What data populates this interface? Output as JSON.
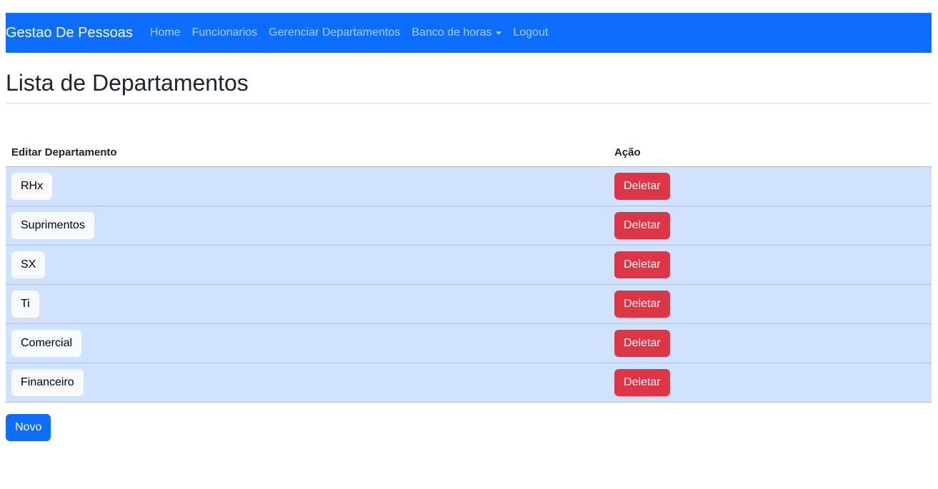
{
  "navbar": {
    "brand": "Gestao De Pessoas",
    "links": [
      {
        "label": "Home"
      },
      {
        "label": "Funcionarios"
      },
      {
        "label": "Gerenciar Departamentos"
      },
      {
        "label": "Banco de horas"
      },
      {
        "label": "Logout"
      }
    ]
  },
  "page": {
    "title": "Lista de Departamentos"
  },
  "table": {
    "headers": [
      "Editar Departamento",
      "Ação"
    ],
    "rows": [
      {
        "name": "RHx",
        "action": "Deletar"
      },
      {
        "name": "Suprimentos",
        "action": "Deletar"
      },
      {
        "name": "SX",
        "action": "Deletar"
      },
      {
        "name": "Ti",
        "action": "Deletar"
      },
      {
        "name": "Comercial",
        "action": "Deletar"
      },
      {
        "name": "Financeiro",
        "action": "Deletar"
      }
    ]
  },
  "actions": {
    "new_label": "Novo"
  },
  "colors": {
    "primary": "#0d6efd",
    "danger": "#dc3545",
    "row_bg": "#cfe2ff"
  }
}
